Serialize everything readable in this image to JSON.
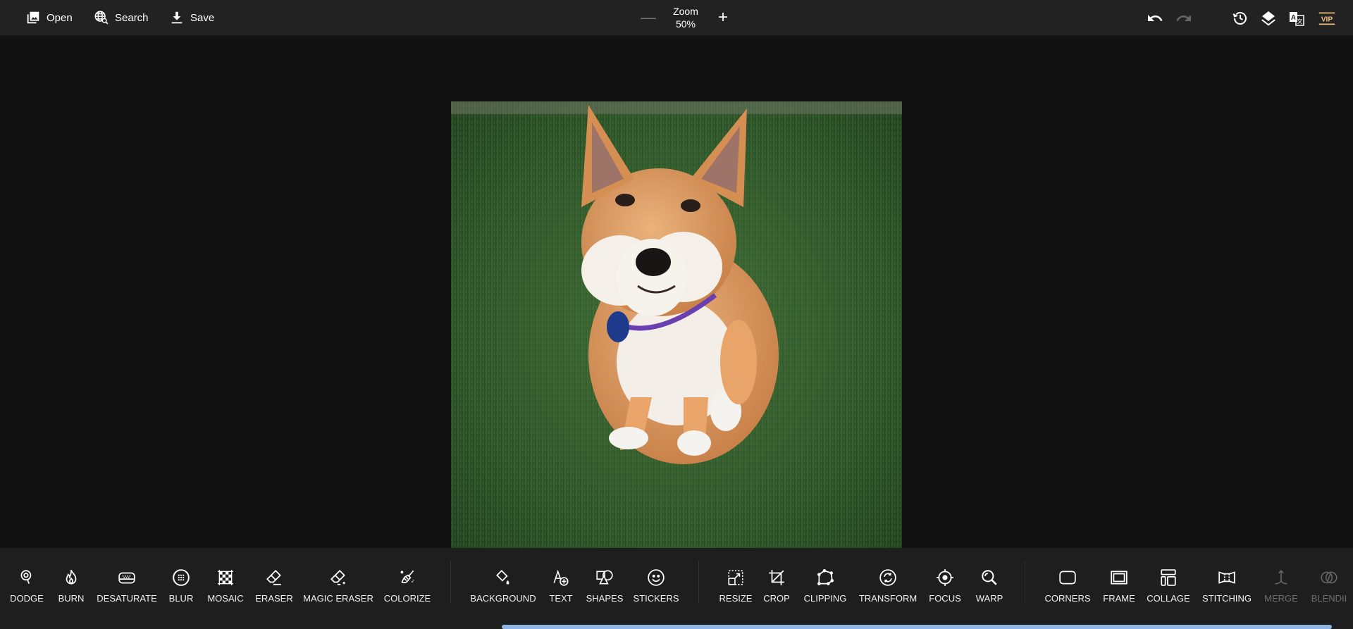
{
  "topbar": {
    "open_label": "Open",
    "search_label": "Search",
    "save_label": "Save",
    "zoom": {
      "title": "Zoom",
      "value": "50%",
      "minus": "—",
      "plus": "+"
    },
    "right_icons": [
      "undo-icon",
      "redo-icon",
      "history-icon",
      "layers-icon",
      "translate-icon",
      "vip-icon"
    ],
    "vip_label": "VIP",
    "vip_color": "#f0c27b"
  },
  "canvas": {
    "image_description": "Shiba Inu dog sitting on green grass"
  },
  "toolbar": {
    "groups": [
      [
        {
          "label": "DODGE",
          "icon": "dodge-icon"
        },
        {
          "label": "BURN",
          "icon": "flame-icon"
        },
        {
          "label": "DESATURATE",
          "icon": "desaturate-icon"
        },
        {
          "label": "BLUR",
          "icon": "blur-icon"
        },
        {
          "label": "MOSAIC",
          "icon": "mosaic-icon"
        },
        {
          "label": "ERASER",
          "icon": "eraser-icon"
        },
        {
          "label": "MAGIC ERASER",
          "icon": "magic-eraser-icon"
        },
        {
          "label": "COLORIZE",
          "icon": "brush-icon"
        }
      ],
      [
        {
          "label": "BACKGROUND",
          "icon": "paint-bucket-icon"
        },
        {
          "label": "TEXT",
          "icon": "text-add-icon"
        },
        {
          "label": "SHAPES",
          "icon": "shapes-icon"
        },
        {
          "label": "STICKERS",
          "icon": "smiley-icon"
        }
      ],
      [
        {
          "label": "RESIZE",
          "icon": "resize-icon"
        },
        {
          "label": "CROP",
          "icon": "crop-icon"
        },
        {
          "label": "CLIPPING",
          "icon": "polygon-icon"
        },
        {
          "label": "TRANSFORM",
          "icon": "transform-icon"
        },
        {
          "label": "FOCUS",
          "icon": "focus-icon"
        },
        {
          "label": "WARP",
          "icon": "warp-icon"
        }
      ],
      [
        {
          "label": "CORNERS",
          "icon": "corners-icon"
        },
        {
          "label": "FRAME",
          "icon": "frame-icon"
        },
        {
          "label": "COLLAGE",
          "icon": "collage-icon"
        },
        {
          "label": "STITCHING",
          "icon": "stitching-icon"
        },
        {
          "label": "MERGE",
          "icon": "merge-icon",
          "disabled": true
        },
        {
          "label": "BLENDII",
          "icon": "blend-icon",
          "disabled": true
        }
      ]
    ]
  },
  "scrollbar": {
    "color": "#8db4e2",
    "position_fraction": 0.37,
    "visible_fraction": 0.61
  }
}
